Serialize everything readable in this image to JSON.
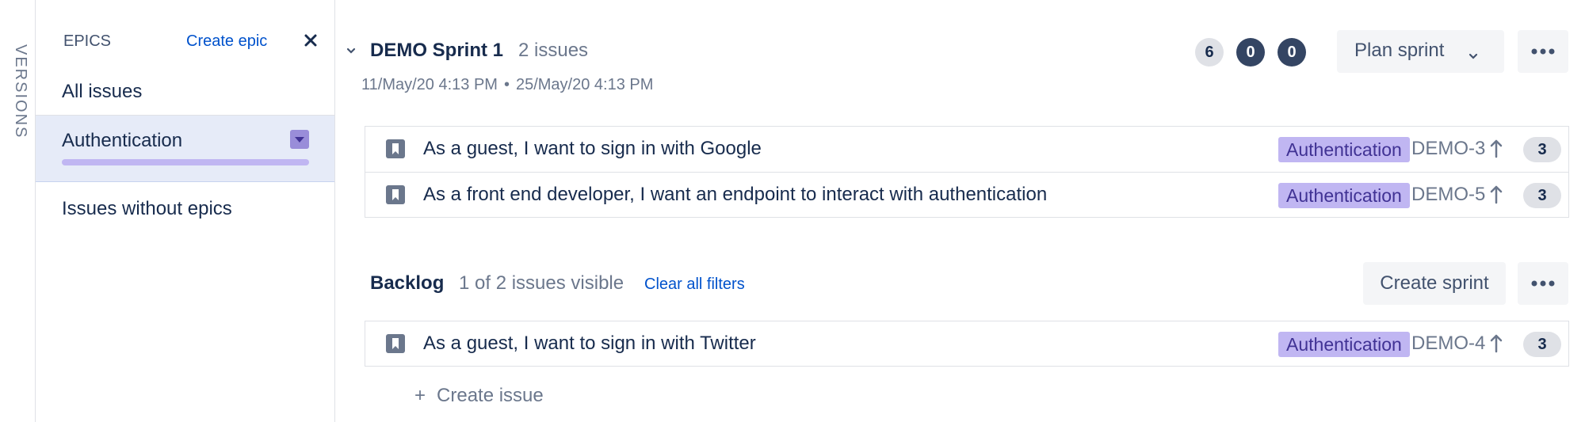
{
  "versions_rail": {
    "label": "VERSIONS"
  },
  "epics_panel": {
    "title": "EPICS",
    "create_epic": "Create epic",
    "items": [
      {
        "label": "All issues",
        "selected": false
      },
      {
        "label": "Authentication",
        "selected": true,
        "color": "#c0b6f2"
      },
      {
        "label": "Issues without epics",
        "selected": false
      }
    ]
  },
  "sprint": {
    "name": "DEMO Sprint 1",
    "issue_count": "2 issues",
    "start_date": "11/May/20 4:13 PM",
    "separator": "•",
    "end_date": "25/May/20 4:13 PM",
    "status_counts": {
      "todo": "6",
      "in_progress": "0",
      "done": "0"
    },
    "plan_button": "Plan sprint",
    "issues": [
      {
        "summary": "As a guest, I want to sign in with Google",
        "epic": "Authentication",
        "key": "DEMO-3",
        "points": "3"
      },
      {
        "summary": "As a front end developer, I want an endpoint to interact with authentication",
        "epic": "Authentication",
        "key": "DEMO-5",
        "points": "3"
      }
    ]
  },
  "backlog": {
    "title": "Backlog",
    "visible_count": "1 of 2 issues visible",
    "clear_filters": "Clear all filters",
    "create_sprint": "Create sprint",
    "issues": [
      {
        "summary": "As a guest, I want to sign in with Twitter",
        "epic": "Authentication",
        "key": "DEMO-4",
        "points": "3"
      }
    ],
    "create_issue": "Create issue",
    "create_issue_icon": "+"
  },
  "colors": {
    "epic_lozenge_bg": "#c0b6f2",
    "epic_lozenge_text": "#403294",
    "selected_epic_bg": "#e6ebf8",
    "link": "#0052cc",
    "status_dark": "#344563"
  },
  "icons": {
    "close": "close-icon",
    "expand": "chevron-down-icon",
    "more": "more-icon",
    "issue_type": "story-icon",
    "priority": "priority-medium-icon"
  }
}
